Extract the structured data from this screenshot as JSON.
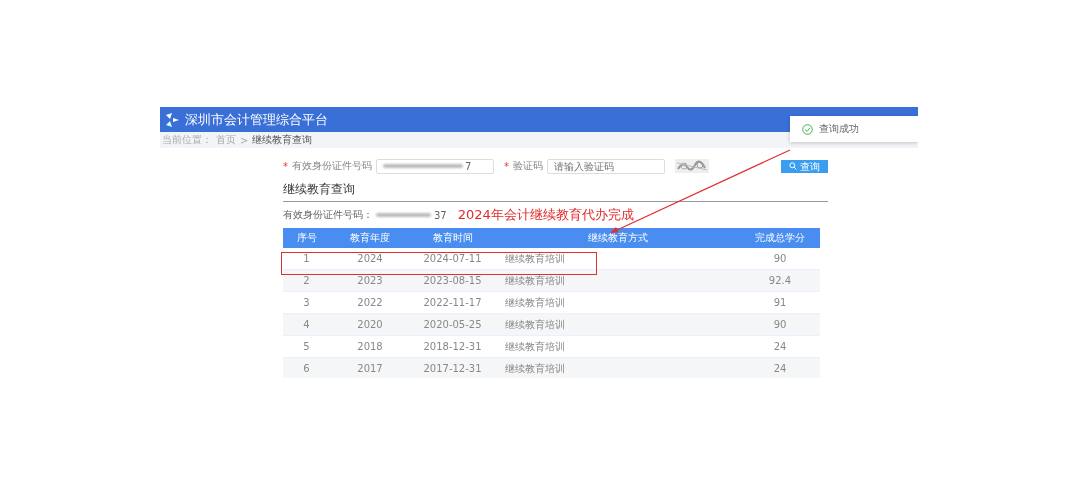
{
  "header": {
    "title": "深圳市会计管理综合平台"
  },
  "toast": {
    "message": "查询成功"
  },
  "breadcrumb": {
    "label": "当前位置：",
    "separator": ">",
    "items": [
      {
        "text": "首页",
        "current": false
      },
      {
        "text": "继续教育查询",
        "current": true
      }
    ]
  },
  "form": {
    "required_mark": "*",
    "id_label": "有效身份证件号码",
    "id_value": "7",
    "captcha_label": "验证码",
    "captcha_placeholder": "请输入验证码",
    "search_button": "查询"
  },
  "section_title": "继续教育查询",
  "id_line": {
    "label": "有效身份证件号码：",
    "value": "37"
  },
  "annotation": "2024年会计继续教育代办完成",
  "table": {
    "columns": [
      "序号",
      "教育年度",
      "教育时间",
      "继续教育方式",
      "完成总学分"
    ],
    "rows": [
      [
        "1",
        "2024",
        "2024-07-11",
        "继续教育培训",
        "90"
      ],
      [
        "2",
        "2023",
        "2023-08-15",
        "继续教育培训",
        "92.4"
      ],
      [
        "3",
        "2022",
        "2022-11-17",
        "继续教育培训",
        "91"
      ],
      [
        "4",
        "2020",
        "2020-05-25",
        "继续教育培训",
        "90"
      ],
      [
        "5",
        "2018",
        "2018-12-31",
        "继续教育培训",
        "24"
      ],
      [
        "6",
        "2017",
        "2017-12-31",
        "继续教育培训",
        "24"
      ]
    ]
  }
}
